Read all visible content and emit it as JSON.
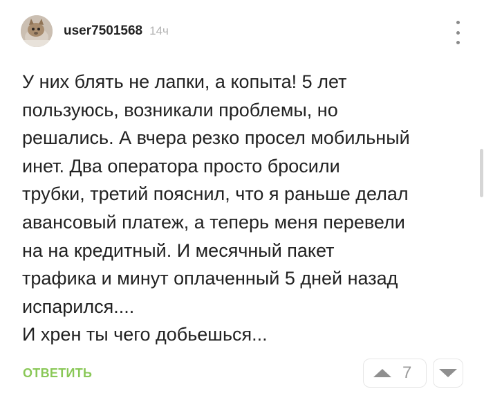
{
  "comment": {
    "author": "user7501568",
    "time": "14ч",
    "avatar_icon": "cat-photo-avatar",
    "menu_icon": "vertical-ellipsis-icon",
    "text": "У них блять не лапки, а копыта! 5 лет\nпользуюсь, возникали проблемы, но\nрешались. А вчера резко просел мобильный\nинет. Два оператора просто бросили\nтрубки, третий пояснил, что я раньше делал\nавансовый платеж, а теперь меня перевели\nна на кредитный. И месячный пакет\nтрафика и минут оплаченный 5 дней назад\nиспарился....\nИ хрен ты чего добьешься...",
    "reply_label": "ОТВЕТИТЬ",
    "rating": "7"
  },
  "colors": {
    "reply": "#8ac858",
    "time": "#b3b3b3",
    "vote_icon": "#8f8f8f",
    "vote_border": "#e6e6e6"
  }
}
